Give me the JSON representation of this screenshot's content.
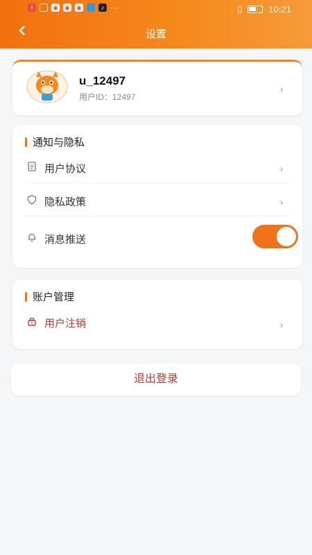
{
  "status_bar": {
    "time": "10:21"
  },
  "header": {
    "title": "设置",
    "back_icon": "chevron-left-icon",
    "color": "#f3700f"
  },
  "profile": {
    "username": "u_12497",
    "user_id_label": "用户ID：12497",
    "avatar": "cartoon-fox-avatar"
  },
  "sections": [
    {
      "title": "通知与隐私",
      "items": [
        {
          "label": "用户协议",
          "icon": "document-icon"
        },
        {
          "label": "隐私政策",
          "icon": "shield-icon"
        },
        {
          "label": "消息推送",
          "icon": "bell-icon",
          "toggle_on": true
        }
      ]
    },
    {
      "title": "账户管理",
      "items": [
        {
          "label": "用户注销",
          "icon": "lock-icon",
          "color": "#c0392b"
        }
      ]
    }
  ],
  "logout_label": "退出登录",
  "accent_color": "#f0731a"
}
